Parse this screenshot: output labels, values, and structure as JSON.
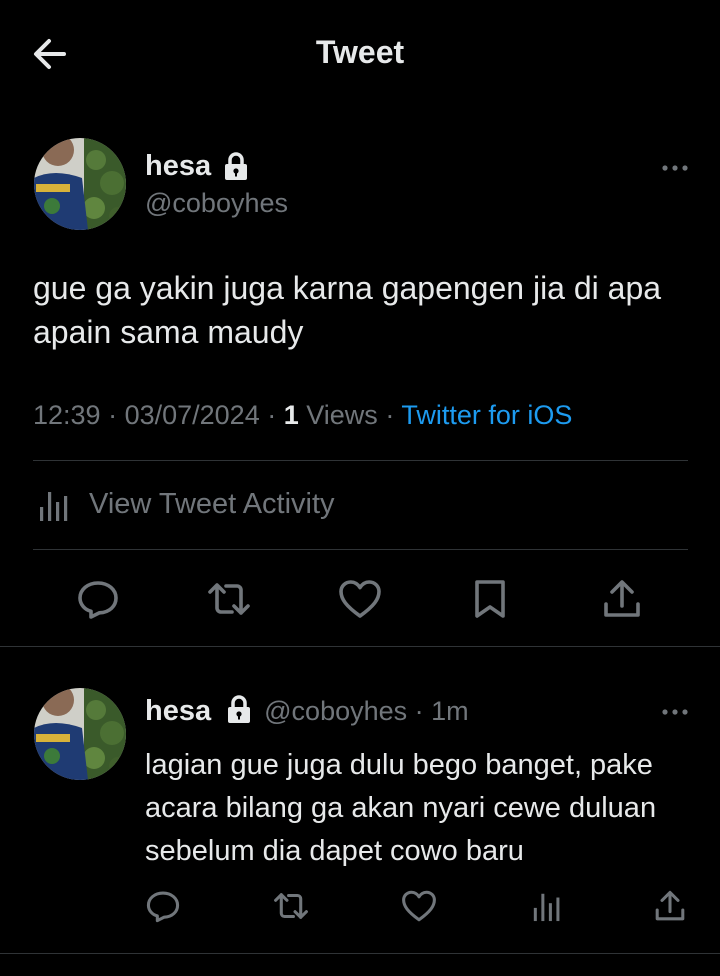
{
  "header": {
    "title": "Tweet",
    "back_icon": "arrow-left-icon"
  },
  "tweet": {
    "author_name": "hesa",
    "author_handle": "@coboyhes",
    "protected_icon": "lock-icon",
    "text": "gue ga yakin juga karna gapengen jia di apa apain sama maudy",
    "time": "12:39",
    "date": "03/07/2024",
    "views_count": "1",
    "views_label": "Views",
    "client": "Twitter for iOS",
    "activity_label": "View Tweet Activity",
    "actions": [
      "reply-icon",
      "retweet-icon",
      "like-icon",
      "bookmark-icon",
      "share-icon"
    ]
  },
  "reply": {
    "author_name": "hesa",
    "author_handle": "@coboyhes",
    "time_ago": "1m",
    "text": "lagian gue juga dulu bego banget, pake acara bilang ga akan nyari cewe duluan sebelum dia dapet cowo baru",
    "actions": [
      "reply-icon",
      "retweet-icon",
      "like-icon",
      "analytics-icon",
      "share-icon"
    ]
  },
  "colors": {
    "background": "#000000",
    "text": "#e7e9ea",
    "secondary": "#71767b",
    "accent": "#1d9bf0",
    "divider": "#2f3336"
  }
}
